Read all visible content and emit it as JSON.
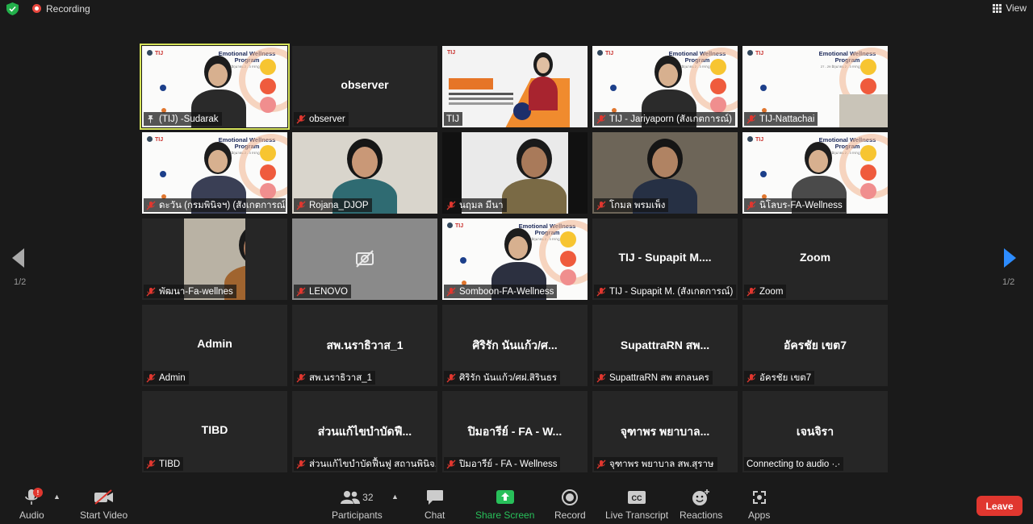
{
  "topbar": {
    "recording": "Recording",
    "view": "View"
  },
  "tiles": [
    {
      "name": "(TIJ) -Sudarak",
      "big": "",
      "kind": "slide-person"
    },
    {
      "name": "observer",
      "big": "observer",
      "kind": "text"
    },
    {
      "name": "TIJ",
      "big": "",
      "kind": "promo"
    },
    {
      "name": "TIJ - Jariyaporn (สังเกตการณ์)",
      "big": "",
      "kind": "slide-person"
    },
    {
      "name": "TIJ-Nattachai",
      "big": "",
      "kind": "slide"
    },
    {
      "name": "ดะวัน (กรมพินิจฯ) (สังเกตการณ์)",
      "big": "",
      "kind": "slide-person"
    },
    {
      "name": "Rojana_DJOP",
      "big": "",
      "kind": "cam"
    },
    {
      "name": "นฤมล  มีนา",
      "big": "",
      "kind": "cam"
    },
    {
      "name": "โกมล  พรมเพ็ง",
      "big": "",
      "kind": "cam"
    },
    {
      "name": "นิโลบร-FA-Wellness",
      "big": "",
      "kind": "slide-person"
    },
    {
      "name": "พัฒนา-Fa-wellnes",
      "big": "",
      "kind": "cam-small"
    },
    {
      "name": "LENOVO",
      "big": "",
      "kind": "camoff"
    },
    {
      "name": "Somboon-FA-Wellness",
      "big": "",
      "kind": "slide-person"
    },
    {
      "name": "TIJ - Supapit M. (สังเกตการณ์)",
      "big": "TIJ - Supapit M....",
      "kind": "text"
    },
    {
      "name": "Zoom",
      "big": "Zoom",
      "kind": "text"
    },
    {
      "name": "Admin",
      "big": "Admin",
      "kind": "text"
    },
    {
      "name": "สพ.นราธิวาส_1",
      "big": "สพ.นราธิวาส_1",
      "kind": "text"
    },
    {
      "name": "ศิริรัก  นันแก้ว/ศฝ.สิรินธร",
      "big": "ศิริรัก  นันแก้ว/ศ...",
      "kind": "text"
    },
    {
      "name": "SupattraRN สพ สกลนคร",
      "big": "SupattraRN สพ...",
      "kind": "text"
    },
    {
      "name": "อัครชัย เขต7",
      "big": "อัครชัย เขต7",
      "kind": "text"
    },
    {
      "name": "TIBD",
      "big": "TIBD",
      "kind": "text"
    },
    {
      "name": "ส่วนแก้ไขบำบัดฟื้นฟู สถานพินิจ...",
      "big": "ส่วนแก้ไขบำบัดฟื...",
      "kind": "text"
    },
    {
      "name": "ปิมอารีย์ - FA - Wellness",
      "big": "ปิมอารีย์ - FA - W...",
      "kind": "text"
    },
    {
      "name": "จุฑาพร พยาบาล สพ.สุราษ",
      "big": "จุฑาพร พยาบาล...",
      "kind": "text"
    },
    {
      "name": "Connecting to audio ·.·",
      "big": "เจนจิรา",
      "kind": "connecting"
    }
  ],
  "slide": {
    "logo": "TIJ",
    "title": "Emotional Wellness Program",
    "subtitle": "27 - 29 มิถุนายน 2 - 3 กรกฎาคม 2565"
  },
  "pages": {
    "left": "1/2",
    "right": "1/2"
  },
  "toolbar": {
    "audio": "Audio",
    "audio_badge": "!",
    "video": "Start Video",
    "participants": "Participants",
    "participants_count": "32",
    "chat": "Chat",
    "share": "Share Screen",
    "record": "Record",
    "transcript": "Live Transcript",
    "reactions": "Reactions",
    "apps": "Apps",
    "leave": "Leave"
  },
  "colors": {
    "active_speaker": "#d6e35a",
    "share_green": "#28c05a",
    "leave_red": "#e0372f",
    "page_arrow": "#2d8cff"
  }
}
